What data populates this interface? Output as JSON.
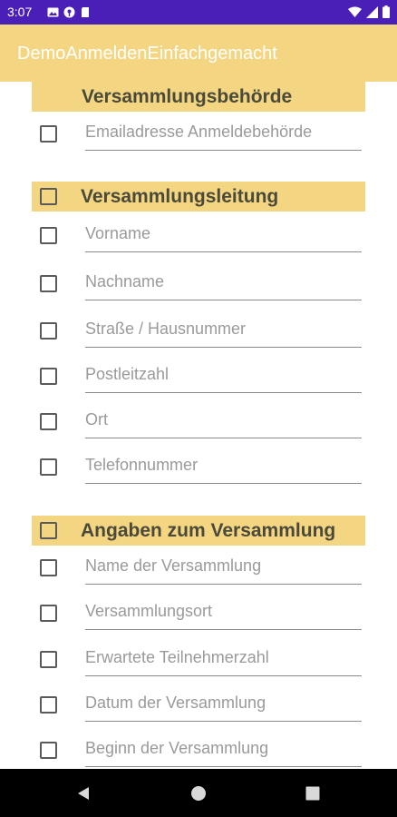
{
  "status_bar": {
    "time": "3:07",
    "left_icons": [
      "image-icon",
      "podcast-icon",
      "sd-card-icon"
    ],
    "right_icons": [
      "wifi-icon",
      "signal-icon",
      "battery-icon"
    ]
  },
  "app_bar": {
    "title": "DemoAnmeldenEinfachgemacht",
    "color": "#f4d581"
  },
  "sections": [
    {
      "title": "Versammlungsbehörde",
      "fields": [
        "Emailadresse Anmeldebehörde"
      ]
    },
    {
      "title": "Versammlungsleitung",
      "fields": [
        "Vorname",
        "Nachname",
        "Straße / Hausnummer",
        "Postleitzahl",
        "Ort",
        "Telefonnummer"
      ]
    },
    {
      "title": "Angaben zum Versammlung",
      "fields": [
        "Name der Versammlung",
        "Versammlungsort",
        "Erwartete Teilnehmerzahl",
        "Datum der Versammlung",
        "Beginn der Versammlung"
      ]
    }
  ],
  "nav_bar": {
    "buttons": [
      "back-icon",
      "home-icon",
      "recents-icon"
    ]
  }
}
